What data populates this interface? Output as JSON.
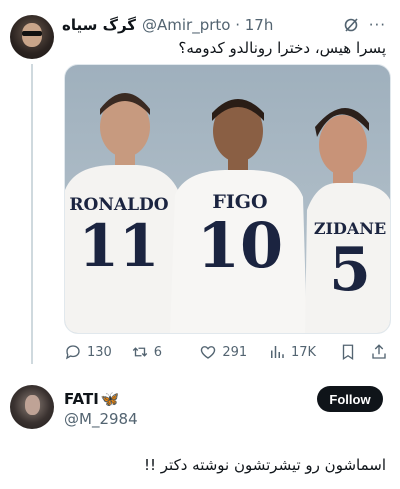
{
  "tweet": {
    "display_name": "گرگ سیاه",
    "handle_time": "@Amir_prto · 17h",
    "text": "پسرا هیس، دخترا رونالدو کدومه؟",
    "icons": [
      "grok-icon",
      "more-icon"
    ],
    "image": {
      "description_icon": "photo",
      "shirts": [
        {
          "name": "RONALDO",
          "number": "11"
        },
        {
          "name": "FIGO",
          "number": "10"
        },
        {
          "name": "ZIDANE",
          "number": "5"
        }
      ]
    },
    "metrics": {
      "replies": "130",
      "retweets": "6",
      "likes": "291",
      "views": "17K"
    }
  },
  "reply": {
    "display_name": "FATI",
    "name_emoji": "🦋",
    "handle": "@M_2984",
    "follow_label": "Follow",
    "text": "اسماشون رو تیشرتشون نوشته دکتر !!"
  },
  "colors": {
    "text_primary": "#0f1419",
    "text_secondary": "#536471",
    "follow_bg": "#0f1419",
    "thread_line": "#cfd9de"
  }
}
